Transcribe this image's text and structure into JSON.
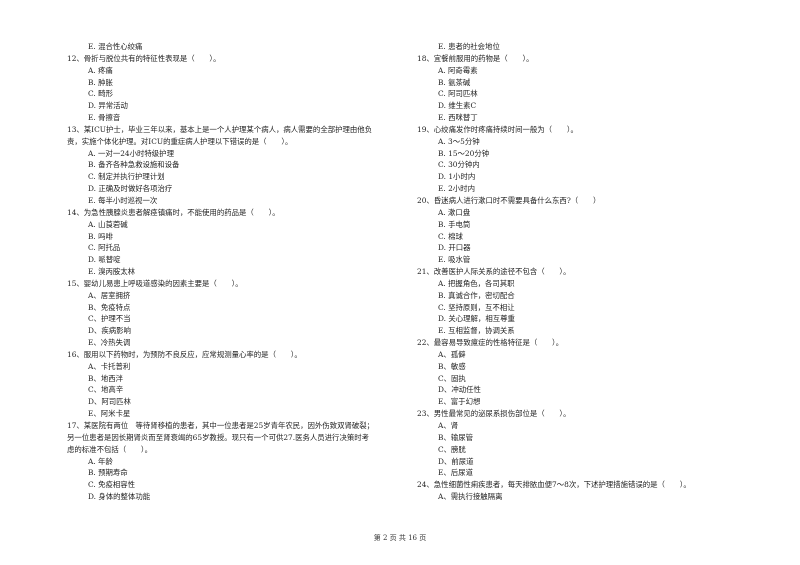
{
  "page": {
    "left_column": [
      {
        "type": "opt",
        "text": "E. 混合性心绞痛"
      },
      {
        "type": "q",
        "text": "12、骨折与脱位共有的特征性表现是（　　）。"
      },
      {
        "type": "opt",
        "text": "A. 疼痛"
      },
      {
        "type": "opt",
        "text": "B. 肿胀"
      },
      {
        "type": "opt",
        "text": "C. 畸形"
      },
      {
        "type": "opt",
        "text": "D. 异常活动"
      },
      {
        "type": "opt",
        "text": "E. 骨擦音"
      },
      {
        "type": "q",
        "text": "13、某ICU护士，毕业三年以来，基本上是一个人护理某个病人，病人需要的全部护理由他负"
      },
      {
        "type": "cont",
        "text": "责，实施个体化护理。对ICU的重症病人护理以下错误的是（　　）。"
      },
      {
        "type": "opt",
        "text": "A. 一对一24小时特级护理"
      },
      {
        "type": "opt",
        "text": "B. 备齐各种急救设施和设备"
      },
      {
        "type": "opt",
        "text": "C. 制定并执行护理计划"
      },
      {
        "type": "opt",
        "text": "D. 正确及时做好各项治疗"
      },
      {
        "type": "opt",
        "text": "E. 每半小时巡视一次"
      },
      {
        "type": "q",
        "text": "14、为急性胰腺炎患者解痉镇痛时，不能使用的药品是（　　）。"
      },
      {
        "type": "opt",
        "text": "A. 山莨菪碱"
      },
      {
        "type": "opt",
        "text": "B. 吗啡"
      },
      {
        "type": "opt",
        "text": "C. 阿托品"
      },
      {
        "type": "opt",
        "text": "D. 哌替啶"
      },
      {
        "type": "opt",
        "text": "E. 溴丙胺太林"
      },
      {
        "type": "q",
        "text": "15、婴幼儿易患上呼吸道感染的因素主要是（　　）。"
      },
      {
        "type": "opt",
        "text": "A、居室拥挤"
      },
      {
        "type": "opt",
        "text": "B、免疫特点"
      },
      {
        "type": "opt",
        "text": "C、护理不当"
      },
      {
        "type": "opt",
        "text": "D、疾病影响"
      },
      {
        "type": "opt",
        "text": "E、冷热失调"
      },
      {
        "type": "q",
        "text": "16、服用以下药物时，为预防不良反应，应常规测量心率的是（　　）。"
      },
      {
        "type": "opt",
        "text": "A、卡托普利"
      },
      {
        "type": "opt",
        "text": "B、地西泮"
      },
      {
        "type": "opt",
        "text": "C、地高辛"
      },
      {
        "type": "opt",
        "text": "D、阿司匹林"
      },
      {
        "type": "opt",
        "text": "E、阿米卡星"
      },
      {
        "type": "q",
        "text": "17、某医院有两位　等待肾移植的患者，其中一位患者是25岁青年农民，因外伤致双肾破裂；"
      },
      {
        "type": "cont",
        "text": "另一位患者是因长期肾炎而至肾衰竭的65岁教授。现只有一个可供27.医务人员进行决策时考"
      },
      {
        "type": "cont",
        "text": "虑的标准不包括（　　）。"
      },
      {
        "type": "opt",
        "text": "A. 年龄"
      },
      {
        "type": "opt",
        "text": "B. 预期寿命"
      },
      {
        "type": "opt",
        "text": "C. 免疫相容性"
      },
      {
        "type": "opt",
        "text": "D. 身体的整体功能"
      }
    ],
    "right_column": [
      {
        "type": "opt",
        "text": "E. 患者的社会地位"
      },
      {
        "type": "q",
        "text": "18、宜餐前服用的药物是（　　）。"
      },
      {
        "type": "opt",
        "text": "A. 阿奇霉素"
      },
      {
        "type": "opt",
        "text": "B. 氨茶碱"
      },
      {
        "type": "opt",
        "text": "C. 阿司匹林"
      },
      {
        "type": "opt",
        "text": "D. 维生素C"
      },
      {
        "type": "opt",
        "text": "E. 西咪替丁"
      },
      {
        "type": "q",
        "text": "19、心绞痛发作时疼痛持续时间一般为（　　）。"
      },
      {
        "type": "opt",
        "text": "A. 3～5分钟"
      },
      {
        "type": "opt",
        "text": "B. 15～20分钟"
      },
      {
        "type": "opt",
        "text": "C. 30分钟内"
      },
      {
        "type": "opt",
        "text": "D. 1小时内"
      },
      {
        "type": "opt",
        "text": "E. 2小时内"
      },
      {
        "type": "q",
        "text": "20、昏迷病人进行漱口时不需要具备什么东西?（　　）"
      },
      {
        "type": "opt",
        "text": "A. 漱口盘"
      },
      {
        "type": "opt",
        "text": "B. 手电筒"
      },
      {
        "type": "opt",
        "text": "C. 棉球"
      },
      {
        "type": "opt",
        "text": "D. 开口器"
      },
      {
        "type": "opt",
        "text": "E. 吸水管"
      },
      {
        "type": "q",
        "text": "21、改善医护人际关系的途径不包含（　　）。"
      },
      {
        "type": "opt",
        "text": "A. 把握角色，各司其职"
      },
      {
        "type": "opt",
        "text": "B. 真诚合作，密切配合"
      },
      {
        "type": "opt",
        "text": "C. 坚持原则，互不相让"
      },
      {
        "type": "opt",
        "text": "D. 关心理解，相互尊重"
      },
      {
        "type": "opt",
        "text": "E. 互相监督，协调关系"
      },
      {
        "type": "q",
        "text": "22、最容易导致癔症的性格特征是（　　）。"
      },
      {
        "type": "opt",
        "text": "A、孤僻"
      },
      {
        "type": "opt",
        "text": "B、敏感"
      },
      {
        "type": "opt",
        "text": "C、固执"
      },
      {
        "type": "opt",
        "text": "D、冲动任性"
      },
      {
        "type": "opt",
        "text": "E、富于幻想"
      },
      {
        "type": "q",
        "text": "23、男性最常见的泌尿系损伤部位是（　　）。"
      },
      {
        "type": "opt",
        "text": "A、肾"
      },
      {
        "type": "opt",
        "text": "B、输尿管"
      },
      {
        "type": "opt",
        "text": "C、膀胱"
      },
      {
        "type": "opt",
        "text": "D、前尿道"
      },
      {
        "type": "opt",
        "text": "E、后尿道"
      },
      {
        "type": "q",
        "text": "24、急性细菌性痢疾患者，每天排脓血便7～8次，下述护理措施错误的是（　　）。"
      },
      {
        "type": "opt",
        "text": "A、需执行接触隔离"
      }
    ],
    "footer": "第 2 页 共 16 页"
  }
}
